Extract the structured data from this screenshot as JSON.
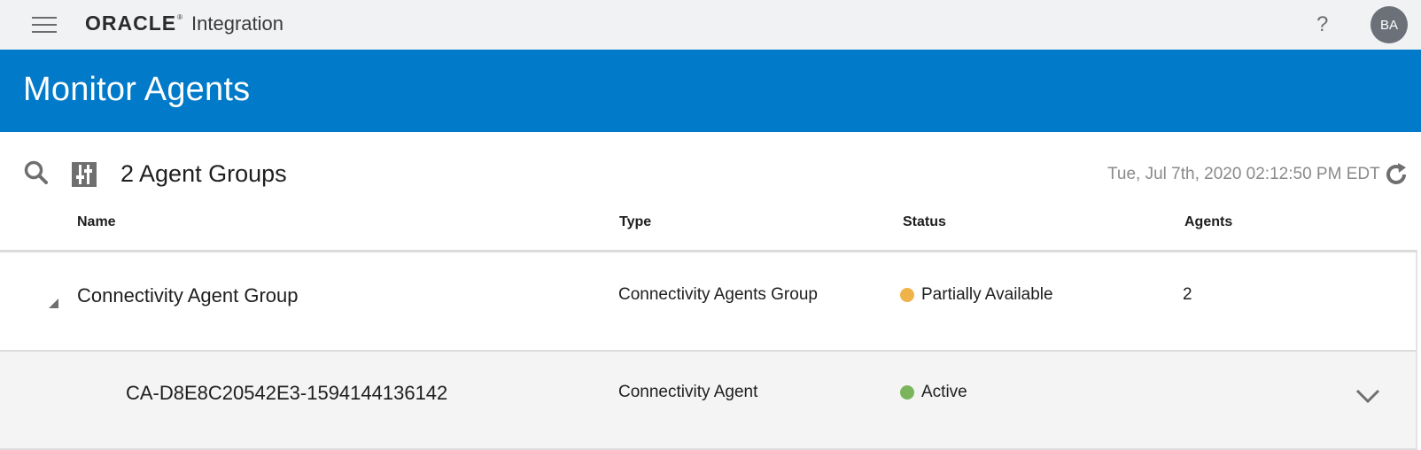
{
  "app": {
    "brand": "ORACLE",
    "product": "Integration",
    "help_label": "?",
    "user_initials": "BA"
  },
  "page": {
    "title": "Monitor Agents"
  },
  "toolbar": {
    "search_icon": "search-icon",
    "filter_icon": "filter-icon",
    "group_count": "2 Agent Groups",
    "timestamp": "Tue, Jul 7th, 2020 02:12:50 PM EDT",
    "refresh_icon": "refresh-icon"
  },
  "table": {
    "columns": [
      "Name",
      "Type",
      "Status",
      "Agents"
    ],
    "rows": [
      {
        "name": "Connectivity Agent Group",
        "type": "Connectivity Agents Group",
        "status": "Partially Available",
        "status_color": "#f0b34a",
        "agents": "2",
        "expanded": true
      },
      {
        "name": "CA-D8E8C20542E3-1594144136142",
        "type": "Connectivity Agent",
        "status": "Active",
        "status_color": "#7ab55c",
        "agents": ""
      }
    ]
  },
  "colors": {
    "header_blue": "#007ac9",
    "topbar_bg": "#f1f2f4",
    "avatar_bg": "#6b7079"
  }
}
